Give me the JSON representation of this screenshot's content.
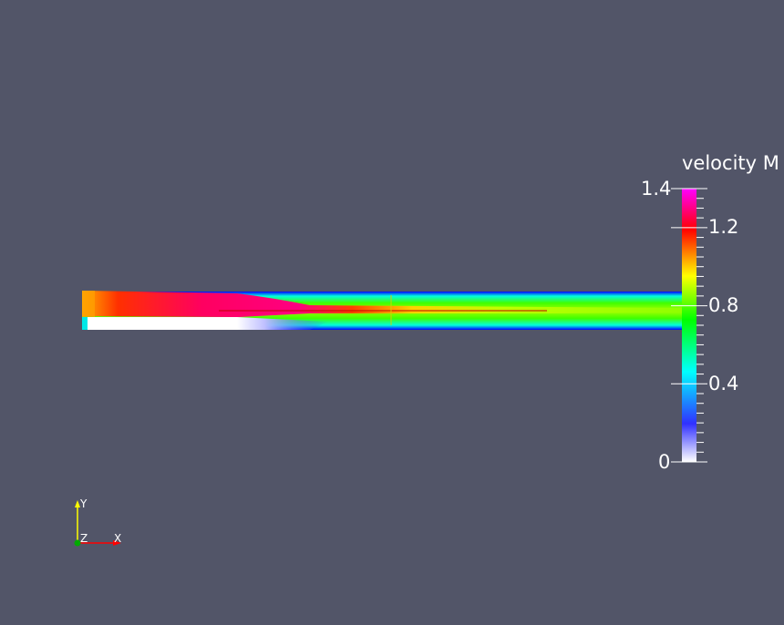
{
  "viewport": {
    "background_color": "#525568",
    "color_map": {
      "title": "velocity M",
      "range": [
        0,
        1.4
      ],
      "tick_labels": [
        "1.4",
        "1.2",
        "0.8",
        "0.4",
        "0"
      ],
      "colors": [
        "#ffffff",
        "#0000ff",
        "#00ffff",
        "#00ff00",
        "#ffff00",
        "#ff0000",
        "#ff00ff"
      ]
    },
    "field": {
      "name": "velocity magnitude",
      "inlet_core_velocity": 1.35,
      "outlet_velocity": 0.8,
      "step_region_velocity": 0.0
    },
    "axes_triad": {
      "x_label": "X",
      "y_label": "Y",
      "z_label": "Z",
      "x_color": "#ff0000",
      "y_color": "#ffff00",
      "z_color": "#00aa00"
    }
  }
}
